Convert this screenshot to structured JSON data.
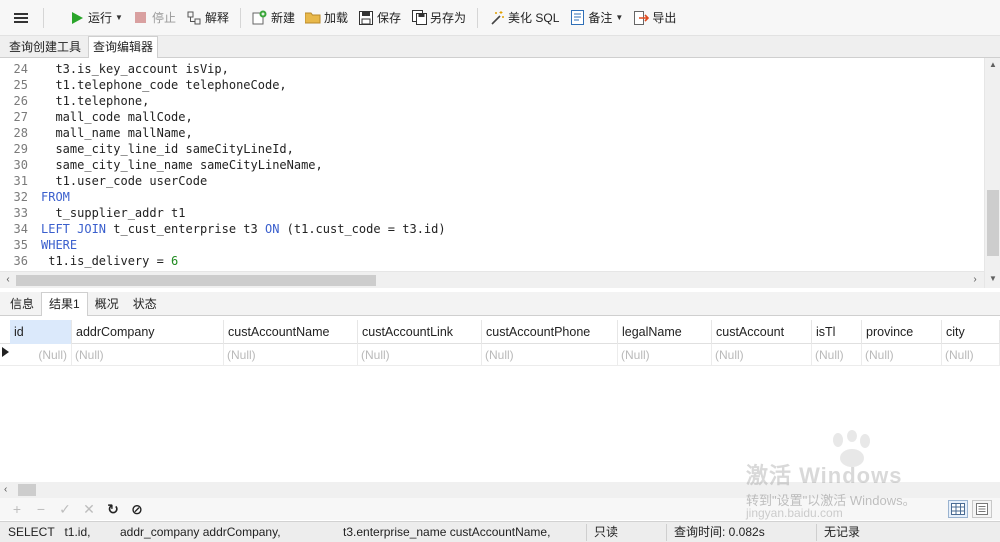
{
  "toolbar": {
    "menu_icon": "hamburger-icon",
    "run": "运行",
    "stop": "停止",
    "explain": "解释",
    "new": "新建",
    "load": "加载",
    "save": "保存",
    "save_as": "另存为",
    "beautify": "美化 SQL",
    "comment": "备注",
    "export": "导出"
  },
  "tabs": [
    "查询创建工具",
    "查询编辑器"
  ],
  "editor": {
    "lines": [
      {
        "n": "24",
        "segments": [
          {
            "t": "  t3.is_key_account isVip,",
            "c": ""
          }
        ]
      },
      {
        "n": "25",
        "segments": [
          {
            "t": "  t1.telephone_code telephoneCode,",
            "c": ""
          }
        ]
      },
      {
        "n": "26",
        "segments": [
          {
            "t": "  t1.telephone,",
            "c": ""
          }
        ]
      },
      {
        "n": "27",
        "segments": [
          {
            "t": "  mall_code mallCode,",
            "c": ""
          }
        ]
      },
      {
        "n": "28",
        "segments": [
          {
            "t": "  mall_name mallName,",
            "c": ""
          }
        ]
      },
      {
        "n": "29",
        "segments": [
          {
            "t": "  same_city_line_id sameCityLineId,",
            "c": ""
          }
        ]
      },
      {
        "n": "30",
        "segments": [
          {
            "t": "  same_city_line_name sameCityLineName,",
            "c": ""
          }
        ]
      },
      {
        "n": "31",
        "segments": [
          {
            "t": "  t1.user_code userCode",
            "c": ""
          }
        ]
      },
      {
        "n": "32",
        "segments": [
          {
            "t": "FROM",
            "c": "kw"
          }
        ]
      },
      {
        "n": "33",
        "segments": [
          {
            "t": "  t_supplier_addr t1",
            "c": ""
          }
        ]
      },
      {
        "n": "34",
        "segments": [
          {
            "t": "LEFT JOIN",
            "c": "kw"
          },
          {
            "t": " t_cust_enterprise t3 ",
            "c": ""
          },
          {
            "t": "ON",
            "c": "kw"
          },
          {
            "t": " (t1.cust_code = t3.id)",
            "c": ""
          }
        ]
      },
      {
        "n": "35",
        "segments": [
          {
            "t": "WHERE",
            "c": "kw"
          }
        ]
      },
      {
        "n": "36",
        "segments": [
          {
            "t": " t1.is_delivery = ",
            "c": ""
          },
          {
            "t": "6",
            "c": "num"
          }
        ]
      }
    ]
  },
  "result_tabs": [
    "信息",
    "结果1",
    "概况",
    "状态"
  ],
  "grid": {
    "columns": [
      "id",
      "addrCompany",
      "custAccountName",
      "custAccountLink",
      "custAccountPhone",
      "legalName",
      "custAccount",
      "isTl",
      "province",
      "city"
    ],
    "row": [
      "(Null)",
      "(Null)",
      "(Null)",
      "(Null)",
      "(Null)",
      "(Null)",
      "(Null)",
      "(Null)",
      "(Null)",
      "(Null)"
    ]
  },
  "grid_tools": [
    "+",
    "−",
    "✓",
    "✕",
    "↻",
    "⊘"
  ],
  "status": {
    "sql_a": "SELECT   t1.id,",
    "sql_b": "addr_company addrCompany,",
    "sql_c": "t3.enterprise_name custAccountName,",
    "readonly": "只读",
    "query_time": "查询时间: 0.082s",
    "records": "无记录"
  },
  "watermark": {
    "big": "激活 Windows",
    "sub": "转到\"设置\"以激活 Windows。",
    "url": "jingyan.baidu.com"
  }
}
